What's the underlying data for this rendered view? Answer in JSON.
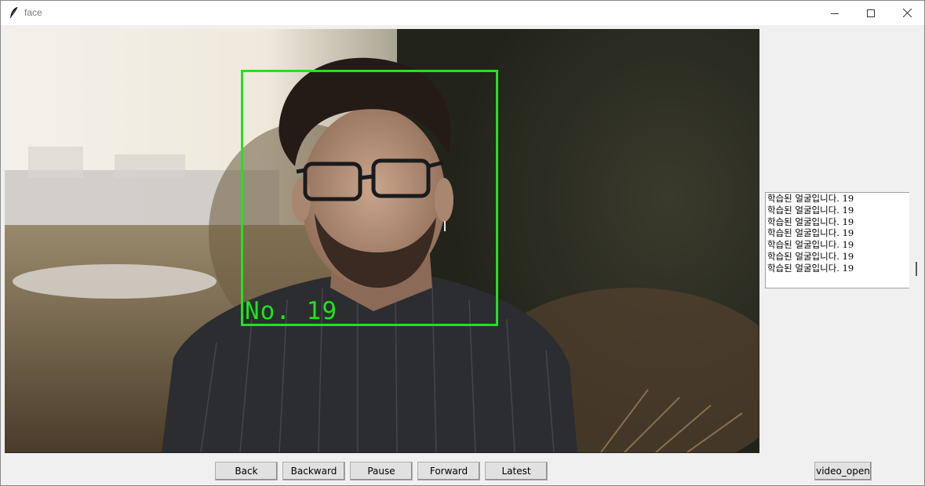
{
  "window": {
    "title": "face"
  },
  "video": {
    "face_label": "No. 19"
  },
  "log": {
    "lines": [
      "학습된 얼굴입니다. 19",
      "학습된 얼굴입니다. 19",
      "학습된 얼굴입니다. 19",
      "학습된 얼굴입니다. 19",
      "학습된 얼굴입니다. 19",
      "학습된 얼굴입니다. 19",
      "학습된 얼굴입니다. 19"
    ]
  },
  "controls": {
    "back": "Back",
    "backward": "Backward",
    "pause": "Pause",
    "forward": "Forward",
    "latest": "Latest",
    "video_open": "video_open"
  },
  "colors": {
    "face_box": "#1ee41e"
  }
}
